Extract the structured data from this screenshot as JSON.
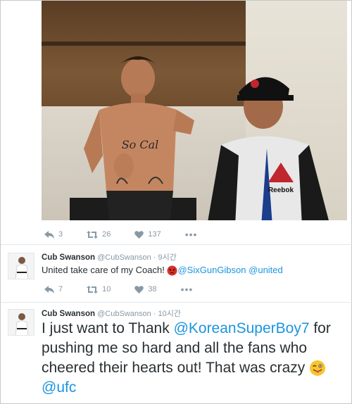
{
  "photo_tweet": {
    "replies": "3",
    "retweets": "26",
    "likes": "137"
  },
  "tweet1": {
    "name": "Cub Swanson",
    "handle": "@CubSwanson",
    "separator": "·",
    "time": "9시간",
    "text_before": "United take care of my Coach!",
    "mention1": "@SixGunGibson",
    "mention2": "@united",
    "replies": "7",
    "retweets": "10",
    "likes": "38"
  },
  "tweet2": {
    "name": "Cub Swanson",
    "handle": "@CubSwanson",
    "separator": "·",
    "time": "10시간",
    "text_a": "I just want to Thank",
    "mention1": "@KoreanSuperBoy7",
    "text_b": "for pushing me so hard and all the fans who cheered their hearts out! That was crazy",
    "mention2": "@ufc"
  },
  "more_label": "•••",
  "colors": {
    "link": "#1b95e0",
    "muted": "#8899a6",
    "text": "#292f33",
    "divider": "#e1e8ed"
  },
  "photo_text": {
    "chest_tattoo": "So Cal",
    "shirt_brand": "Reebok"
  }
}
